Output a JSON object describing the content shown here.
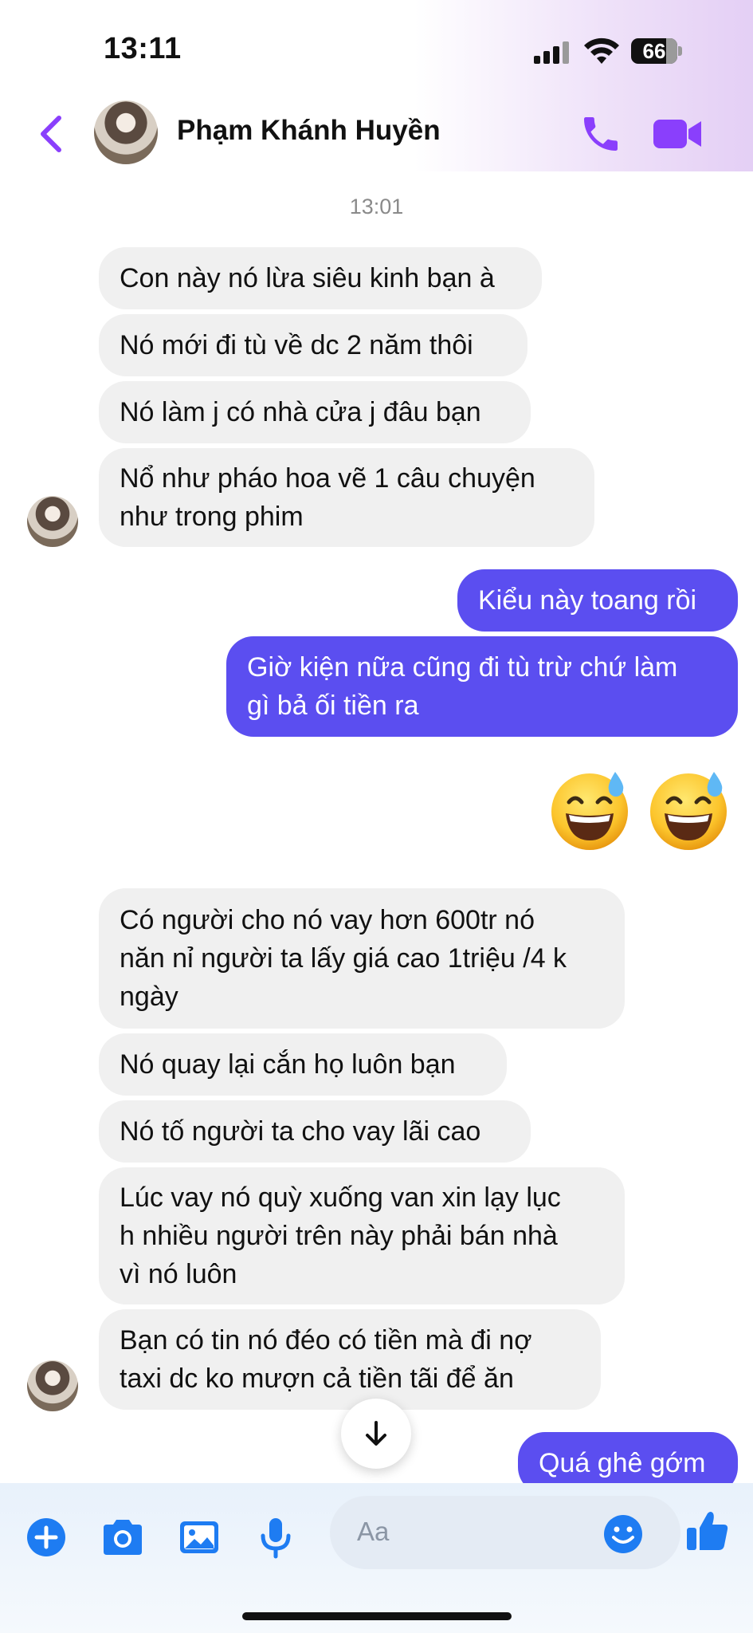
{
  "status_bar": {
    "time": "13:11",
    "battery": "66"
  },
  "header": {
    "contact_name": "Phạm Khánh Huyền"
  },
  "conversation": {
    "timestamp": "13:01",
    "messages": [
      {
        "from": "them",
        "text": "Con này nó lừa siêu kinh bạn à"
      },
      {
        "from": "them",
        "text": "Nó mới đi tù về dc 2 năm thôi"
      },
      {
        "from": "them",
        "text": "Nó làm j có nhà cửa j đâu bạn"
      },
      {
        "from": "them",
        "text": "Nổ như pháo hoa vẽ 1 câu chuyện\nnhư trong phim"
      },
      {
        "from": "me",
        "text": "Kiểu này toang rồi"
      },
      {
        "from": "me",
        "text": "Giờ kiện nữa cũng đi tù trừ chứ làm\ngì bả ối tiền ra"
      },
      {
        "from": "me",
        "emoji": "grinning-face-with-sweat x2"
      },
      {
        "from": "them",
        "text": "Có người cho nó vay hơn 600tr nó\nnăn nỉ người ta lấy giá cao 1triệu /4 k\nngày"
      },
      {
        "from": "them",
        "text": "Nó quay lại cắn họ luôn bạn"
      },
      {
        "from": "them",
        "text": "Nó tố người ta cho vay lãi cao"
      },
      {
        "from": "them",
        "text": "Lúc vay nó quỳ xuống van xin lạy lục\nh nhiều người trên này phải bán nhà\nvì nó luôn"
      },
      {
        "from": "them",
        "text": "Bạn có tin nó đéo có tiền mà đi nợ\ntaxi dc ko mượn cả tiền tãi để ăn"
      },
      {
        "from": "me",
        "text": "Quá ghê gớm"
      }
    ]
  },
  "composer": {
    "placeholder": "Aa"
  },
  "colors": {
    "accent": "#8a3ffc",
    "outgoing_bubble": "#5b4ef0",
    "incoming_bubble": "#f0f0f0",
    "composer_icons": "#1e7cf2"
  }
}
